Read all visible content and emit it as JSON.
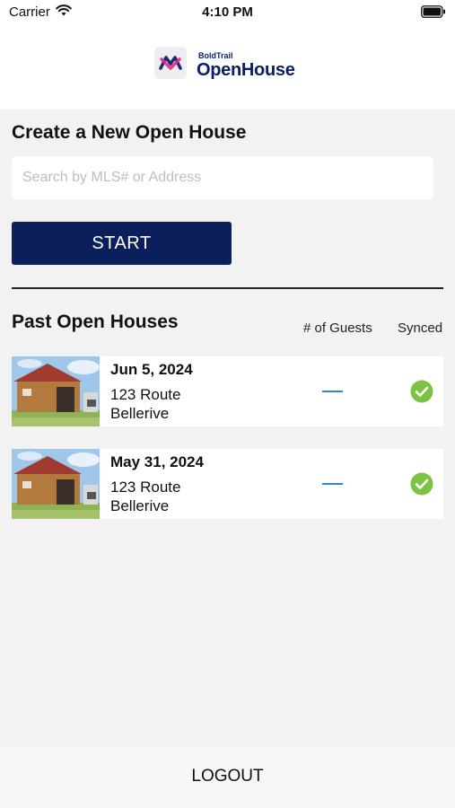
{
  "status_bar": {
    "carrier": "Carrier",
    "time": "4:10 PM"
  },
  "header": {
    "logo_small": "BoldTrail",
    "logo_big": "OpenHouse"
  },
  "create": {
    "title": "Create a New Open House",
    "search_placeholder": "Search by MLS# or Address",
    "start_label": "START"
  },
  "past": {
    "title": "Past Open Houses",
    "col_guests": "# of Guests",
    "col_synced": "Synced",
    "items": [
      {
        "date": "Jun 5, 2024",
        "address_line1": "123 Route",
        "address_line2": "Bellerive",
        "guests": "—",
        "synced": true
      },
      {
        "date": "May 31, 2024",
        "address_line1": "123 Route",
        "address_line2": "Bellerive",
        "guests": "—",
        "synced": true
      }
    ]
  },
  "footer": {
    "logout_label": "LOGOUT"
  },
  "colors": {
    "brand_navy": "#0b1f5c",
    "synced_green": "#7cc243",
    "dash_blue": "#2f86d6"
  }
}
